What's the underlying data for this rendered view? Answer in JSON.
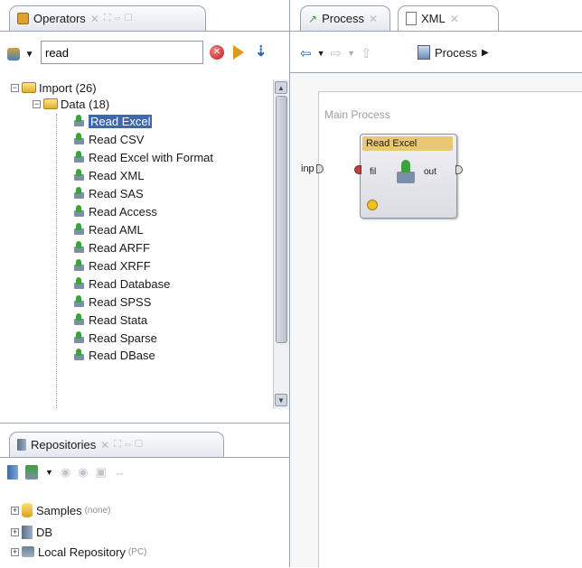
{
  "operators_panel": {
    "tab_label": "Operators",
    "search_value": "read",
    "tree": {
      "import": "Import (26)",
      "data": "Data (18)",
      "items": [
        "Read Excel",
        "Read CSV",
        "Read Excel with Format",
        "Read XML",
        "Read SAS",
        "Read Access",
        "Read AML",
        "Read ARFF",
        "Read XRFF",
        "Read Database",
        "Read SPSS",
        "Read Stata",
        "Read Sparse",
        "Read DBase"
      ]
    }
  },
  "repositories_panel": {
    "tab_label": "Repositories",
    "tree": [
      {
        "label": "Samples",
        "note": "(none)"
      },
      {
        "label": "DB",
        "note": ""
      },
      {
        "label": "Local Repository",
        "note": "(PC)"
      }
    ]
  },
  "editor": {
    "tabs": [
      {
        "label": "Process"
      },
      {
        "label": "XML"
      }
    ],
    "breadcrumb": "Process",
    "canvas_title": "Main Process",
    "input_port": "inp",
    "operator": {
      "title": "Read Excel",
      "in_port": "fil",
      "out_port": "out"
    }
  },
  "colors": {
    "selection": "#3f67b0",
    "border": "#9aa3b0",
    "operator_header": "#e9c873"
  }
}
